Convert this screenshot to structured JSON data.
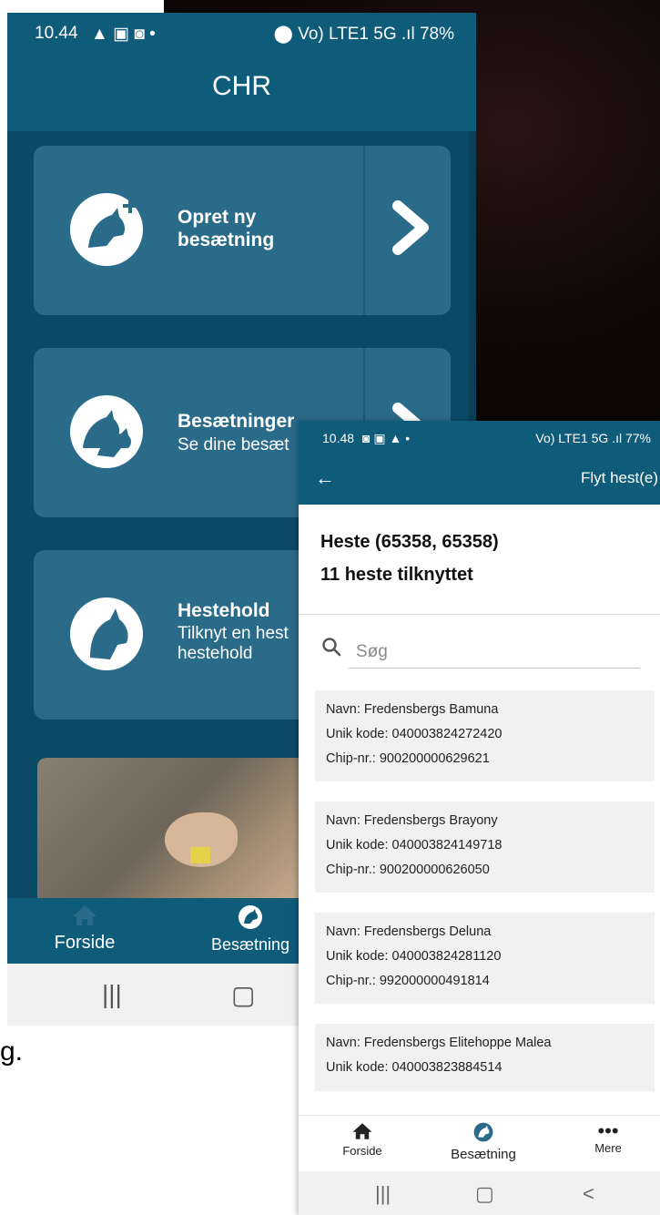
{
  "left_phone": {
    "status": {
      "time": "10.44",
      "indicators": "Vo) LTE1 5G .ıl 78%",
      "battery": "78%"
    },
    "title": "CHR",
    "cards": [
      {
        "title": "Opret ny",
        "title2": "besætning",
        "subtitle": "",
        "icon": "horse-plus-icon"
      },
      {
        "title": "Besætninger",
        "title2": "",
        "subtitle": "Se dine besæt",
        "icon": "horse-herd-icon"
      },
      {
        "title": "Hestehold",
        "title2": "",
        "subtitle": "Tilknyt en hest",
        "subtitle2": "hestehold",
        "icon": "horse-head-icon"
      }
    ],
    "nav": [
      {
        "label": "Forside",
        "icon": "home-icon"
      },
      {
        "label": "Besætning",
        "icon": "herd-icon"
      }
    ]
  },
  "caption_fragment": "g.",
  "right_phone": {
    "status": {
      "time": "10.48",
      "indicators": "Vo) LTE1 5G .ıl 77%"
    },
    "appbar": {
      "back": "←",
      "action": "Flyt hest(e)"
    },
    "heading": "Heste (65358, 65358)",
    "count_text": "11 heste tilknyttet",
    "search": {
      "placeholder": "Søg",
      "value": ""
    },
    "horses": [
      {
        "name": "Navn: Fredensbergs Bamuna",
        "code": "Unik kode: 040003824272420",
        "chip": "Chip-nr.: 900200000629621"
      },
      {
        "name": "Navn: Fredensbergs Brayony",
        "code": "Unik kode: 040003824149718",
        "chip": "Chip-nr.: 900200000626050"
      },
      {
        "name": "Navn: Fredensbergs Deluna",
        "code": "Unik kode: 040003824281120",
        "chip": "Chip-nr.: 992000000491814"
      },
      {
        "name": "Navn: Fredensbergs Elitehoppe Malea",
        "code": "Unik kode: 040003823884514",
        "chip": ""
      }
    ],
    "nav": [
      {
        "label": "Forside",
        "icon": "home-icon"
      },
      {
        "label": "Besætning",
        "icon": "herd-icon"
      },
      {
        "label": "Mere",
        "icon": "more-icon"
      }
    ]
  },
  "colors": {
    "primary": "#0f5b7a",
    "card": "#2a6b8a",
    "content_bg": "#0a4a67",
    "list_item": "#f1f1f1"
  }
}
